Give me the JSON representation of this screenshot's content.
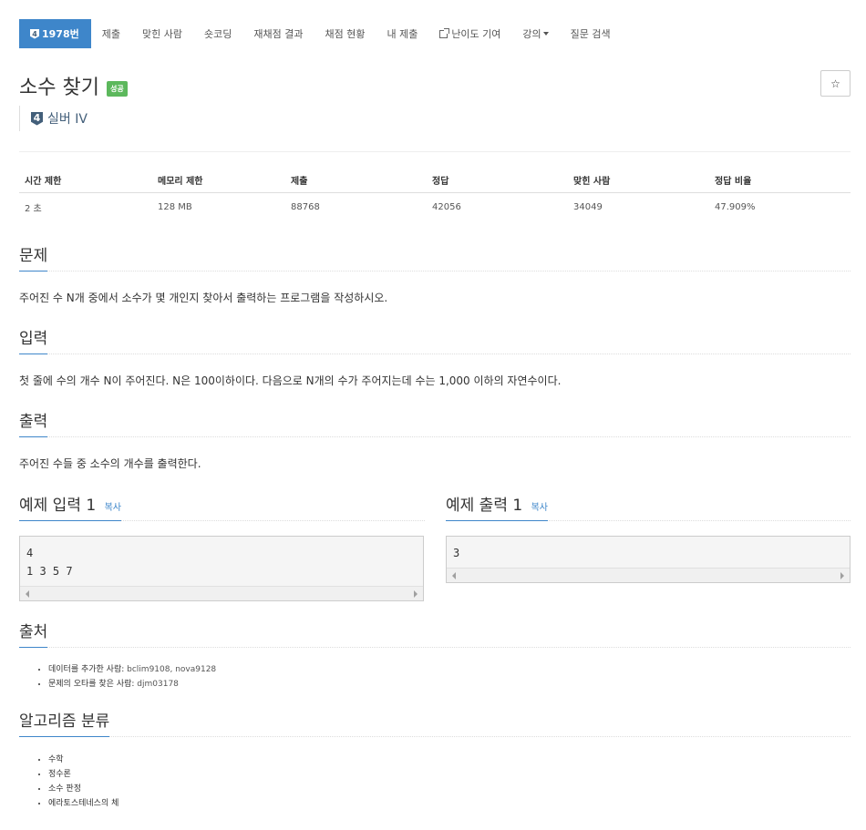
{
  "nav": {
    "items": [
      {
        "label": "1978번",
        "tier": "4"
      },
      {
        "label": "제출"
      },
      {
        "label": "맞힌 사람"
      },
      {
        "label": "숏코딩"
      },
      {
        "label": "재채점 결과"
      },
      {
        "label": "채점 현황"
      },
      {
        "label": "내 제출"
      },
      {
        "label": "난이도 기여"
      },
      {
        "label": "강의"
      },
      {
        "label": "질문 검색"
      }
    ]
  },
  "problem": {
    "title": "소수 찾기",
    "status": "성공",
    "star": "☆",
    "tier_number": "4",
    "tier_label": "실버 IV"
  },
  "info": {
    "headers": [
      "시간 제한",
      "메모리 제한",
      "제출",
      "정답",
      "맞힌 사람",
      "정답 비율"
    ],
    "values": [
      "2 초",
      "128 MB",
      "88768",
      "42056",
      "34049",
      "47.909%"
    ]
  },
  "sections": {
    "description": {
      "heading": "문제",
      "text": "주어진 수 N개 중에서 소수가 몇 개인지 찾아서 출력하는 프로그램을 작성하시오."
    },
    "input": {
      "heading": "입력",
      "text": "첫 줄에 수의 개수 N이 주어진다. N은 100이하이다. 다음으로 N개의 수가 주어지는데 수는 1,000 이하의 자연수이다."
    },
    "output": {
      "heading": "출력",
      "text": "주어진 수들 중 소수의 개수를 출력한다."
    }
  },
  "samples": {
    "input_heading": "예제 입력 1",
    "output_heading": "예제 출력 1",
    "copy_label": "복사",
    "input_text": "4\n1 3 5 7",
    "output_text": "3"
  },
  "source": {
    "heading": "출처",
    "items": [
      {
        "label": "데이터를 추가한 사람: ",
        "users": "bclim9108, nova9128"
      },
      {
        "label": "문제의 오타를 찾은 사람: ",
        "users": "djm03178"
      }
    ]
  },
  "algorithms": {
    "heading": "알고리즘 분류",
    "items": [
      "수학",
      "정수론",
      "소수 판정",
      "에라토스테네스의 체"
    ]
  },
  "colors": {
    "accent": "#3e86ca",
    "success": "#5cb85c",
    "tier": "#435f7a"
  }
}
